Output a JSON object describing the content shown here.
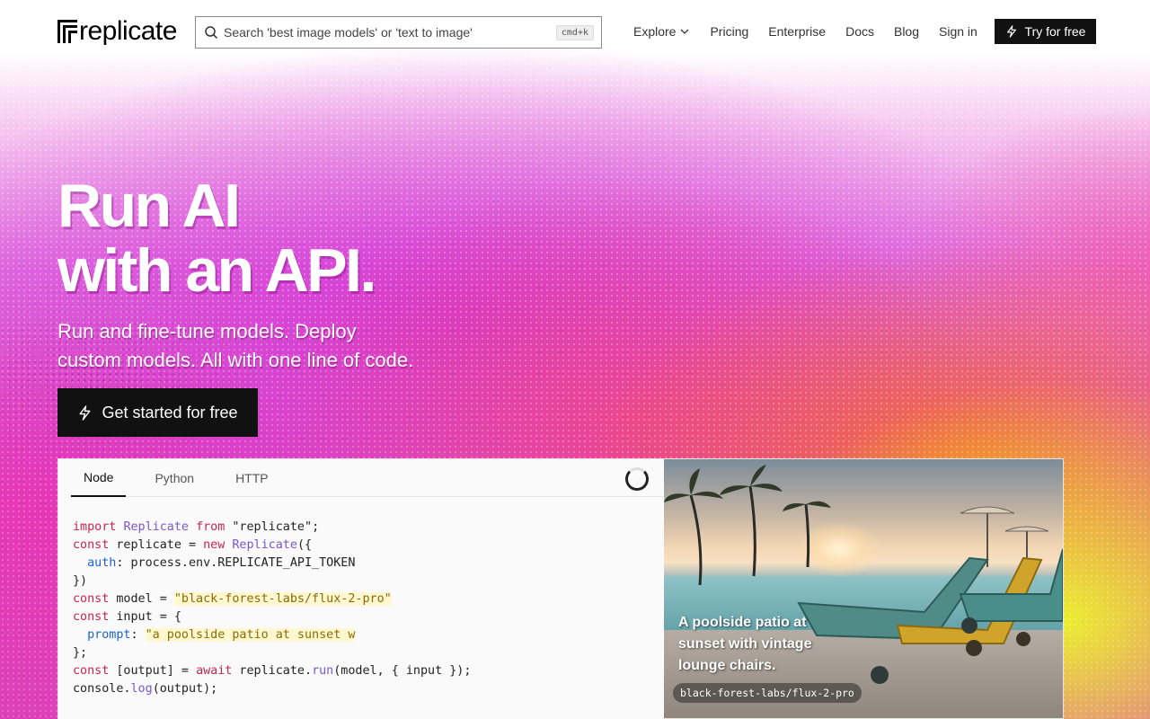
{
  "brand": {
    "logo_text": "replicate"
  },
  "search": {
    "placeholder": "Search 'best image models' or 'text to image'",
    "shortcut": "cmd+k"
  },
  "nav": {
    "items": [
      {
        "label": "Explore",
        "has_dropdown": true
      },
      {
        "label": "Pricing"
      },
      {
        "label": "Enterprise"
      },
      {
        "label": "Docs"
      },
      {
        "label": "Blog"
      },
      {
        "label": "Sign in"
      }
    ],
    "cta_label": "Try for free"
  },
  "hero": {
    "title_line1": "Run AI",
    "title_line2": "with an API.",
    "subtitle_line1": "Run and fine-tune models. Deploy",
    "subtitle_line2": "custom models. All with one line of code.",
    "cta_label": "Get started for free"
  },
  "code_panel": {
    "tabs": [
      {
        "label": "Node",
        "active": true
      },
      {
        "label": "Python",
        "active": false
      },
      {
        "label": "HTTP",
        "active": false
      }
    ],
    "lines": [
      [
        [
          "kw",
          "import"
        ],
        [
          "t",
          " "
        ],
        [
          "cls",
          "Replicate"
        ],
        [
          "t",
          " "
        ],
        [
          "kw",
          "from"
        ],
        [
          "t",
          " "
        ],
        [
          "t",
          "\"replicate\""
        ],
        [
          "t",
          ";"
        ]
      ],
      [
        [
          "kw",
          "const"
        ],
        [
          "t",
          " replicate = "
        ],
        [
          "kw",
          "new"
        ],
        [
          "t",
          " "
        ],
        [
          "cls",
          "Replicate"
        ],
        [
          "t",
          "({"
        ]
      ],
      [
        [
          "t",
          "  "
        ],
        [
          "prop",
          "auth"
        ],
        [
          "t",
          ": process.env.REPLICATE_API_TOKEN"
        ]
      ],
      [
        [
          "t",
          "})"
        ]
      ],
      [
        [
          "kw",
          "const"
        ],
        [
          "t",
          " model = "
        ],
        [
          "str",
          "\"black-forest-labs/flux-2-pro\""
        ]
      ],
      [
        [
          "kw",
          "const"
        ],
        [
          "t",
          " input = {"
        ]
      ],
      [
        [
          "t",
          "  "
        ],
        [
          "prop",
          "prompt"
        ],
        [
          "t",
          ": "
        ],
        [
          "str",
          "\"a poolside patio at sunset w"
        ]
      ],
      [
        [
          "t",
          "};"
        ]
      ],
      [
        [
          "kw",
          "const"
        ],
        [
          "t",
          " [output] = "
        ],
        [
          "kw",
          "await"
        ],
        [
          "t",
          " replicate."
        ],
        [
          "fn",
          "run"
        ],
        [
          "t",
          "(model, { input });"
        ]
      ],
      [
        [
          "t",
          "console."
        ],
        [
          "fn",
          "log"
        ],
        [
          "t",
          "(output);"
        ]
      ]
    ]
  },
  "preview": {
    "caption": "A poolside patio at sunset with vintage lounge chairs.",
    "model_tag": "black-forest-labs/flux-2-pro"
  }
}
